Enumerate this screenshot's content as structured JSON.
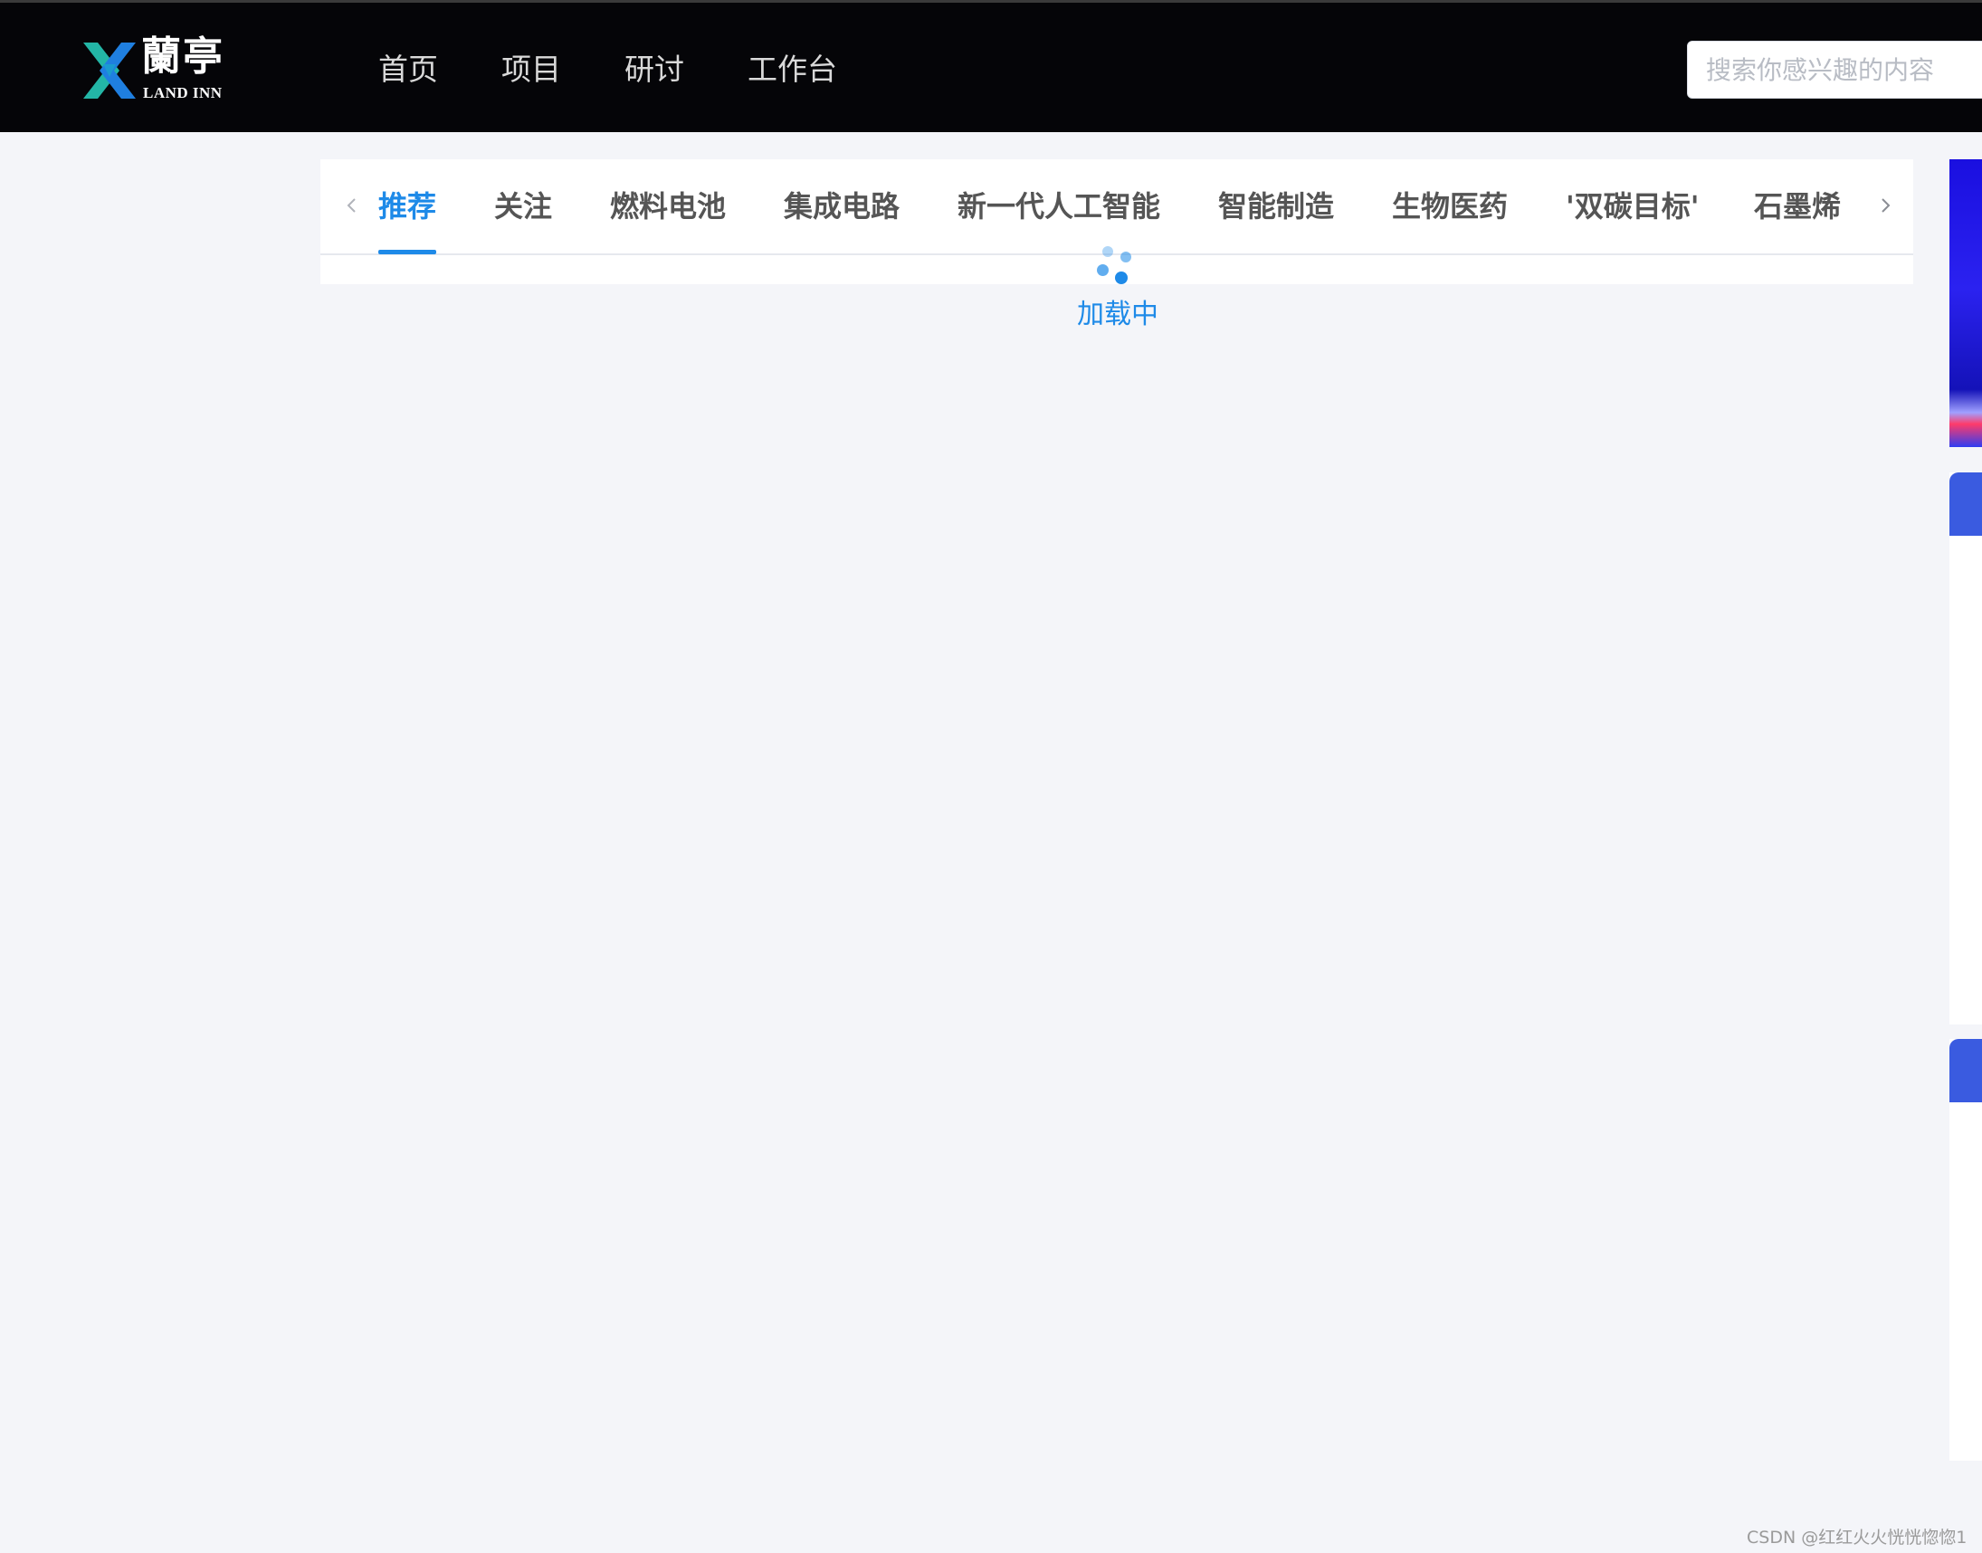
{
  "header": {
    "logo_cn": "蘭亭",
    "logo_en": "LAND INN",
    "nav": [
      {
        "label": "首页"
      },
      {
        "label": "项目"
      },
      {
        "label": "研讨"
      },
      {
        "label": "工作台"
      }
    ],
    "search": {
      "placeholder": "搜索你感兴趣的内容",
      "value": ""
    }
  },
  "tabs": {
    "items": [
      {
        "label": "推荐",
        "active": true
      },
      {
        "label": "关注",
        "active": false
      },
      {
        "label": "燃料电池",
        "active": false
      },
      {
        "label": "集成电路",
        "active": false
      },
      {
        "label": "新一代人工智能",
        "active": false
      },
      {
        "label": "智能制造",
        "active": false
      },
      {
        "label": "生物医药",
        "active": false
      },
      {
        "label": "'双碳目标'",
        "active": false
      },
      {
        "label": "石墨烯",
        "active": false
      }
    ],
    "active_color": "#1e8ae8"
  },
  "loading": {
    "text": "加载中"
  },
  "watermark": "CSDN @红红火火恍恍惚惚1",
  "colors": {
    "header_bg": "#050508",
    "page_bg": "#f4f5f9",
    "accent": "#1e8ae8",
    "side_card_head": "#3a5be0"
  }
}
